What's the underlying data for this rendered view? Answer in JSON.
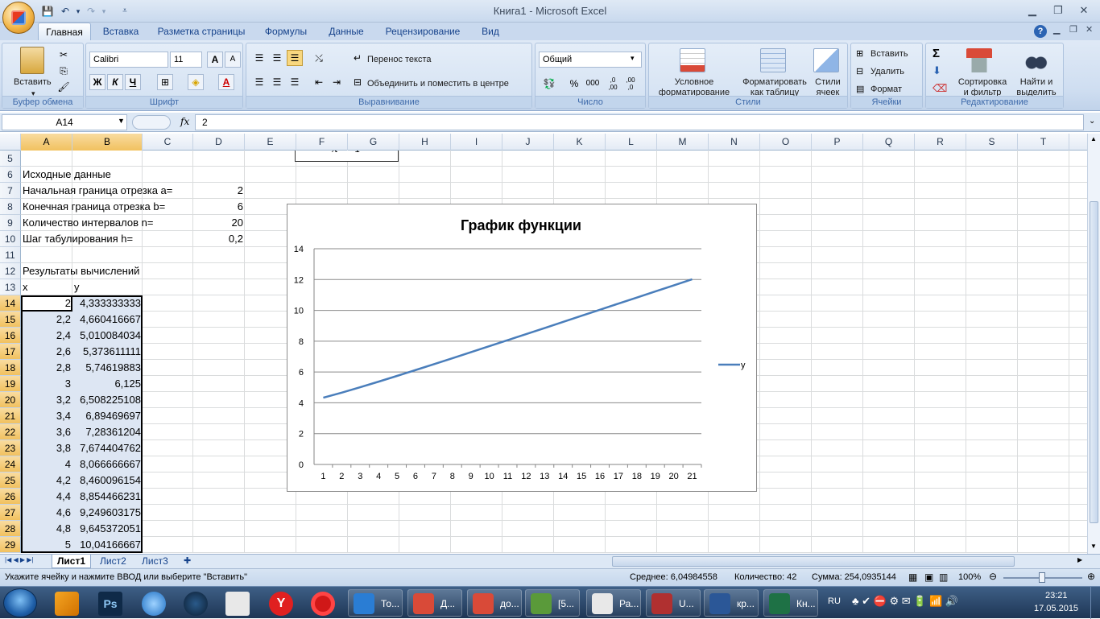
{
  "window": {
    "title": "Книга1  -  Microsoft Excel"
  },
  "ribbon_tabs": [
    "Главная",
    "Вставка",
    "Разметка страницы",
    "Формулы",
    "Данные",
    "Рецензирование",
    "Вид"
  ],
  "ribbon": {
    "clipboard": {
      "label": "Буфер обмена",
      "paste": "Вставить"
    },
    "font": {
      "label": "Шрифт",
      "name": "Calibri",
      "size": "11",
      "bold": "Ж",
      "italic": "К",
      "underline": "Ч",
      "grow": "A",
      "shrink": "A"
    },
    "alignment": {
      "label": "Выравнивание",
      "wrap": "Перенос текста",
      "merge": "Объединить и поместить в центре"
    },
    "number": {
      "label": "Число",
      "format": "Общий",
      "percent": "%",
      "thousands": "000",
      "inc_dec": ",0\n,00",
      "dec_dec": ",00\n,0"
    },
    "styles": {
      "label": "Стили",
      "conditional": "Условное\nформатирование",
      "as_table": "Форматировать\nкак таблицу",
      "cell_styles": "Стили\nячеек"
    },
    "cells": {
      "label": "Ячейки",
      "insert": "Вставить",
      "delete": "Удалить",
      "format": "Формат"
    },
    "editing": {
      "label": "Редактирование",
      "sort": "Сортировка\nи фильтр",
      "find": "Найти и\nвыделить"
    }
  },
  "formula_bar": {
    "name_box": "A14",
    "fx": "fx",
    "content": "2"
  },
  "columns": [
    "A",
    "B",
    "C",
    "D",
    "E",
    "F",
    "G",
    "H",
    "I",
    "J",
    "K",
    "L",
    "M",
    "N",
    "O",
    "P",
    "Q",
    "R",
    "S",
    "T"
  ],
  "rows": [
    "5",
    "6",
    "7",
    "8",
    "9",
    "10",
    "11",
    "12",
    "13",
    "14",
    "15",
    "16",
    "17",
    "18",
    "19",
    "20",
    "21",
    "22",
    "23",
    "24",
    "25",
    "26",
    "27",
    "28",
    "29"
  ],
  "cells": {
    "A6": "Исходные данные",
    "A7": "Начальная граница отрезка a=",
    "D7": "2",
    "A8": "Конечная граница отрезка b=",
    "D8": "6",
    "A9": "Количество интервалов n=",
    "D9": "20",
    "A10": "Шаг табулирования h=",
    "D10": "0,2",
    "A12": "Результаты вычислений",
    "A13": "x",
    "B13": "y"
  },
  "table": {
    "x": [
      "2",
      "2,2",
      "2,4",
      "2,6",
      "2,8",
      "3",
      "3,2",
      "3,4",
      "3,6",
      "3,8",
      "4",
      "4,2",
      "4,4",
      "4,6",
      "4,8",
      "5"
    ],
    "y": [
      "4,333333333",
      "4,660416667",
      "5,010084034",
      "5,373611111",
      "5,74619883",
      "6,125",
      "6,508225108",
      "6,89469697",
      "7,28361204",
      "7,674404762",
      "8,066666667",
      "8,460096154",
      "8,854466231",
      "9,249603175",
      "9,645372051",
      "10,04166667"
    ]
  },
  "partial_formula_text": "x  − 1",
  "chart_data": {
    "type": "line",
    "title": "График функции",
    "categories": [
      1,
      2,
      3,
      4,
      5,
      6,
      7,
      8,
      9,
      10,
      11,
      12,
      13,
      14,
      15,
      16,
      17,
      18,
      19,
      20,
      21
    ],
    "series": [
      {
        "name": "y",
        "values": [
          4.333,
          4.66,
          5.01,
          5.374,
          5.746,
          6.125,
          6.508,
          6.895,
          7.284,
          7.674,
          8.067,
          8.46,
          8.854,
          9.25,
          9.645,
          10.042,
          10.44,
          10.83,
          11.23,
          11.62,
          12.02
        ]
      }
    ],
    "ylim": [
      0,
      14
    ],
    "yticks": [
      0,
      2,
      4,
      6,
      8,
      10,
      12,
      14
    ],
    "legend": "right",
    "grid": true,
    "color": "#4a7ebb"
  },
  "sheets": [
    "Лист1",
    "Лист2",
    "Лист3"
  ],
  "status": {
    "message": "Укажите ячейку и нажмите ВВОД или выберите \"Вставить\"",
    "average": "Среднее: 6,04984558",
    "count": "Количество: 42",
    "sum": "Сумма: 254,0935144",
    "zoom": "100%"
  },
  "taskbar": {
    "items": [
      {
        "label": "То...",
        "color": "#2a7dd4"
      },
      {
        "label": "Д...",
        "color": "#d94a38"
      },
      {
        "label": "до...",
        "color": "#d94a38"
      },
      {
        "label": "[5...",
        "color": "#5a9a3a"
      },
      {
        "label": "Ра...",
        "color": "#e8e8e8"
      },
      {
        "label": "U...",
        "color": "#b03030"
      },
      {
        "label": "кр...",
        "color": "#2b5797"
      },
      {
        "label": "Кн...",
        "color": "#1e7145"
      }
    ],
    "language": "RU",
    "time": "23:21",
    "date": "17.05.2015"
  }
}
